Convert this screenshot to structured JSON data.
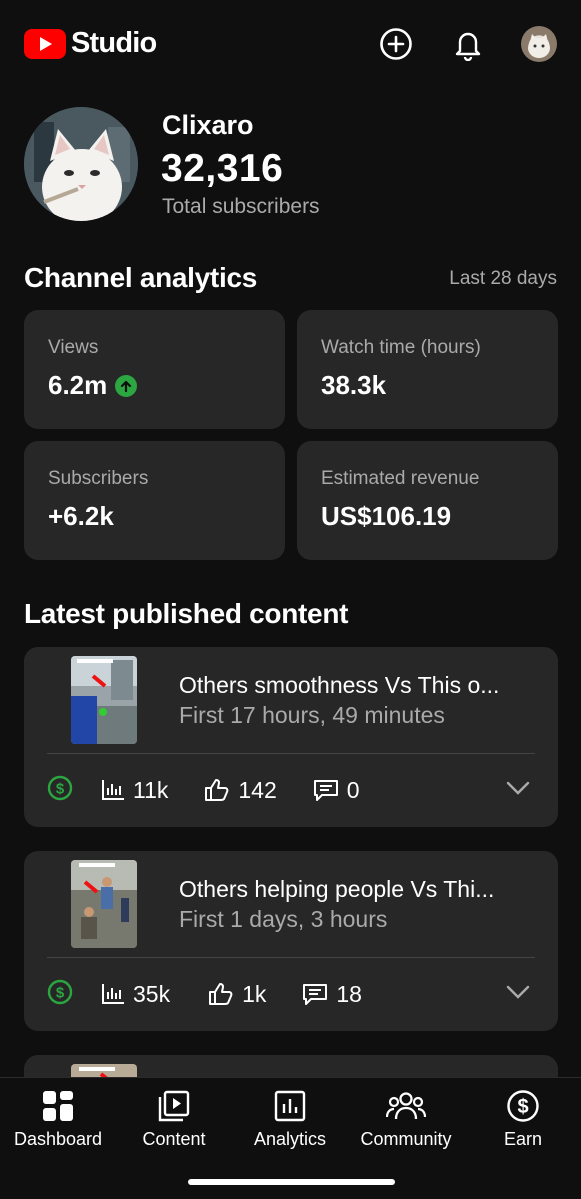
{
  "header": {
    "logo_text": "Studio",
    "icons": [
      "create-icon",
      "bell-icon",
      "account-avatar"
    ]
  },
  "channel": {
    "name": "Clixaro",
    "subscribers": "32,316",
    "subscribers_label": "Total subscribers"
  },
  "analytics": {
    "title": "Channel analytics",
    "range": "Last 28 days",
    "cards": [
      {
        "label": "Views",
        "value": "6.2m",
        "trend": "up",
        "trend_color": "#2ba640"
      },
      {
        "label": "Watch time (hours)",
        "value": "38.3k"
      },
      {
        "label": "Subscribers",
        "value": "+6.2k"
      },
      {
        "label": "Estimated revenue",
        "value": "US$106.19"
      }
    ]
  },
  "latest": {
    "title": "Latest published content",
    "items": [
      {
        "title": "Others smoothness Vs This o...",
        "subtitle": "First 17 hours, 49 minutes",
        "views": "11k",
        "likes": "142",
        "comments": "0",
        "monetization_color": "#2ba640"
      },
      {
        "title": "Others helping people Vs Thi...",
        "subtitle": "First 1 days, 3 hours",
        "views": "35k",
        "likes": "1k",
        "comments": "18",
        "monetization_color": "#2ba640"
      }
    ]
  },
  "nav": {
    "items": [
      {
        "label": "Dashboard",
        "icon": "dashboard-icon"
      },
      {
        "label": "Content",
        "icon": "content-icon"
      },
      {
        "label": "Analytics",
        "icon": "analytics-icon"
      },
      {
        "label": "Community",
        "icon": "community-icon"
      },
      {
        "label": "Earn",
        "icon": "earn-icon"
      }
    ]
  },
  "colors": {
    "background": "#0f0f0f",
    "card": "#272727",
    "secondary_text": "#aaaaaa",
    "brand_red": "#ff0000"
  }
}
